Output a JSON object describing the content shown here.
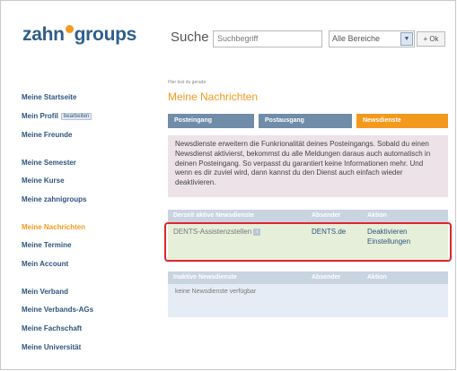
{
  "header": {
    "logo_left": "zahn",
    "logo_right": "groups",
    "search_label": "Suche",
    "search_placeholder": "Suchbegriff",
    "scope_selected": "Alle Bereiche",
    "ok_label": "+ Ok"
  },
  "sidebar": {
    "items": [
      {
        "label": "Meine Startseite"
      },
      {
        "label": "Mein Profil",
        "badge": "bearbeiten"
      },
      {
        "label": "Meine Freunde"
      },
      {
        "label": "Meine Semester"
      },
      {
        "label": "Meine Kurse"
      },
      {
        "label": "Meine zahnigroups"
      },
      {
        "label": "Meine Nachrichten",
        "active": true
      },
      {
        "label": "Meine Termine"
      },
      {
        "label": "Mein Account"
      },
      {
        "label": "Mein Verband"
      },
      {
        "label": "Meine Verbands-AGs"
      },
      {
        "label": "Meine Fachschaft"
      },
      {
        "label": "Meine Universität"
      }
    ]
  },
  "main": {
    "breadcrumb": "Hier bist du gerade:",
    "title": "Meine Nachrichten",
    "tabs": [
      {
        "label": "Posteingang",
        "active": false
      },
      {
        "label": "Postausgang",
        "active": false
      },
      {
        "label": "Newsdienste",
        "active": true
      }
    ],
    "info_text": "Newsdienste erweitern die Funkrionalität deines Posteingangs. Sobald du einen Newsdienst aktivierst, bekommst du alle Meldungen daraus auch automatisch in deinen Posteingang. So verpasst du garantiert keine Informationen mehr. Und wenn es dir zuviel wird, dann kannst du den Dienst auch einfach wieder deaktivieren.",
    "active_table": {
      "headers": [
        "Derzeit aktive Newsdienste",
        "Absender",
        "Aktion"
      ],
      "rows": [
        {
          "name": "DENTS-Assistenzstellen",
          "sender": "DENTS.de",
          "actions": [
            "Deaktivieren",
            "Einstellungen"
          ]
        }
      ]
    },
    "inactive_table": {
      "headers": [
        "Inaktive Newsdienste",
        "Absender",
        "Aktion"
      ],
      "empty_text": "keine Newsdienste verfügbar"
    }
  },
  "colors": {
    "brand_blue": "#2f5e8b",
    "accent_orange": "#f39a1e",
    "highlight_red": "#e0242c"
  }
}
